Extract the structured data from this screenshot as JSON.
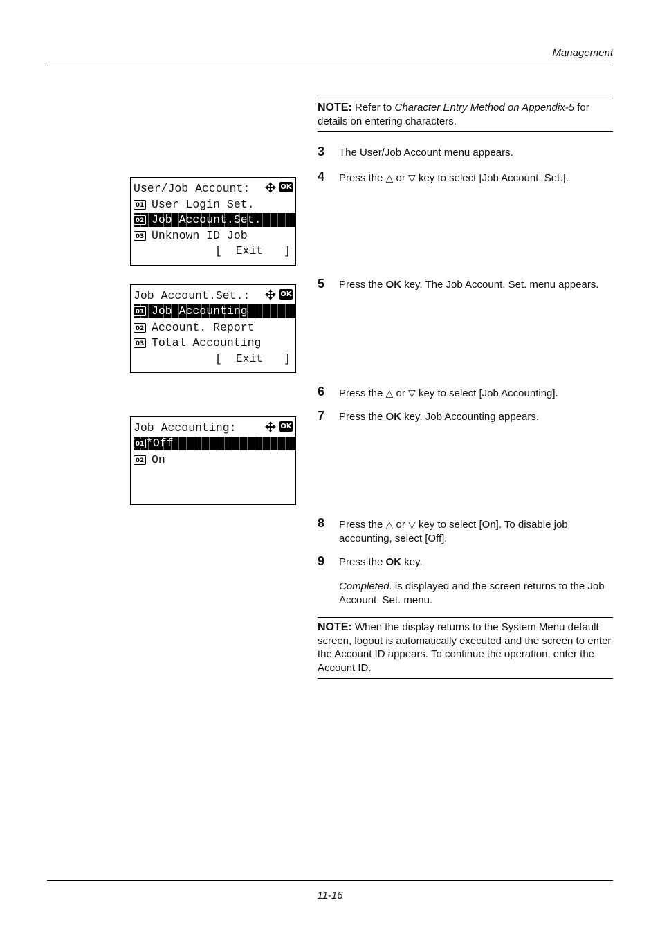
{
  "header": {
    "section": "Management"
  },
  "footer": {
    "page_number": "11-16"
  },
  "note_top": {
    "label": "NOTE:",
    "pre": " Refer to ",
    "ref": "Character Entry Method on Appendix-5",
    "post": " for details on entering characters."
  },
  "steps": [
    {
      "num": "3",
      "parts": [
        "The User/Job Account menu appears."
      ]
    },
    {
      "num": "4",
      "pre": "Press the ",
      "up": "△",
      "mid": " or ",
      "down": "▽",
      "post": " key to select [Job Account. Set.]."
    },
    {
      "num": "5",
      "pre": "Press the ",
      "key": "OK",
      "post": " key. The Job Account. Set. menu appears."
    },
    {
      "num": "6",
      "pre": "Press the ",
      "up": "△",
      "mid": " or ",
      "down": "▽",
      "post": " key to select [Job Accounting]."
    },
    {
      "num": "7",
      "pre": "Press the ",
      "key": "OK",
      "post": " key. Job Accounting appears."
    },
    {
      "num": "8",
      "pre": "Press the ",
      "up": "△",
      "mid": " or ",
      "down": "▽",
      "post": " key to select [On]. To disable job accounting, select [Off]."
    },
    {
      "num": "9",
      "pre": "Press the ",
      "key": "OK",
      "post": " key.",
      "extra_italic": "Completed",
      "extra_rest": ". is displayed and the screen returns to the Job Account. Set. menu."
    }
  ],
  "note_bottom": {
    "label": "NOTE:",
    "text": " When the display returns to the System Menu default screen, logout is automatically executed and the screen to enter the Account ID appears. To continue the operation, enter the Account ID."
  },
  "screens": [
    {
      "title": "User/Job Account:",
      "ok_label": "OK",
      "items": [
        {
          "badge": "01",
          "label": "User Login Set.",
          "selected": false
        },
        {
          "badge": "02",
          "label": "Job Account.Set.",
          "selected": true
        },
        {
          "badge": "03",
          "label": "Unknown ID Job",
          "selected": false
        }
      ],
      "footer": "[  Exit   ]"
    },
    {
      "title": "Job Account.Set.:",
      "ok_label": "OK",
      "items": [
        {
          "badge": "01",
          "label": "Job Accounting",
          "selected": true
        },
        {
          "badge": "02",
          "label": "Account. Report",
          "selected": false
        },
        {
          "badge": "03",
          "label": "Total Accounting",
          "selected": false
        }
      ],
      "footer": "[  Exit   ]"
    },
    {
      "title": "Job Accounting:",
      "ok_label": "OK",
      "items": [
        {
          "badge": "01",
          "label": "*Off",
          "selected": true
        },
        {
          "badge": "02",
          "label": "On",
          "selected": false
        }
      ],
      "footer": ""
    }
  ]
}
